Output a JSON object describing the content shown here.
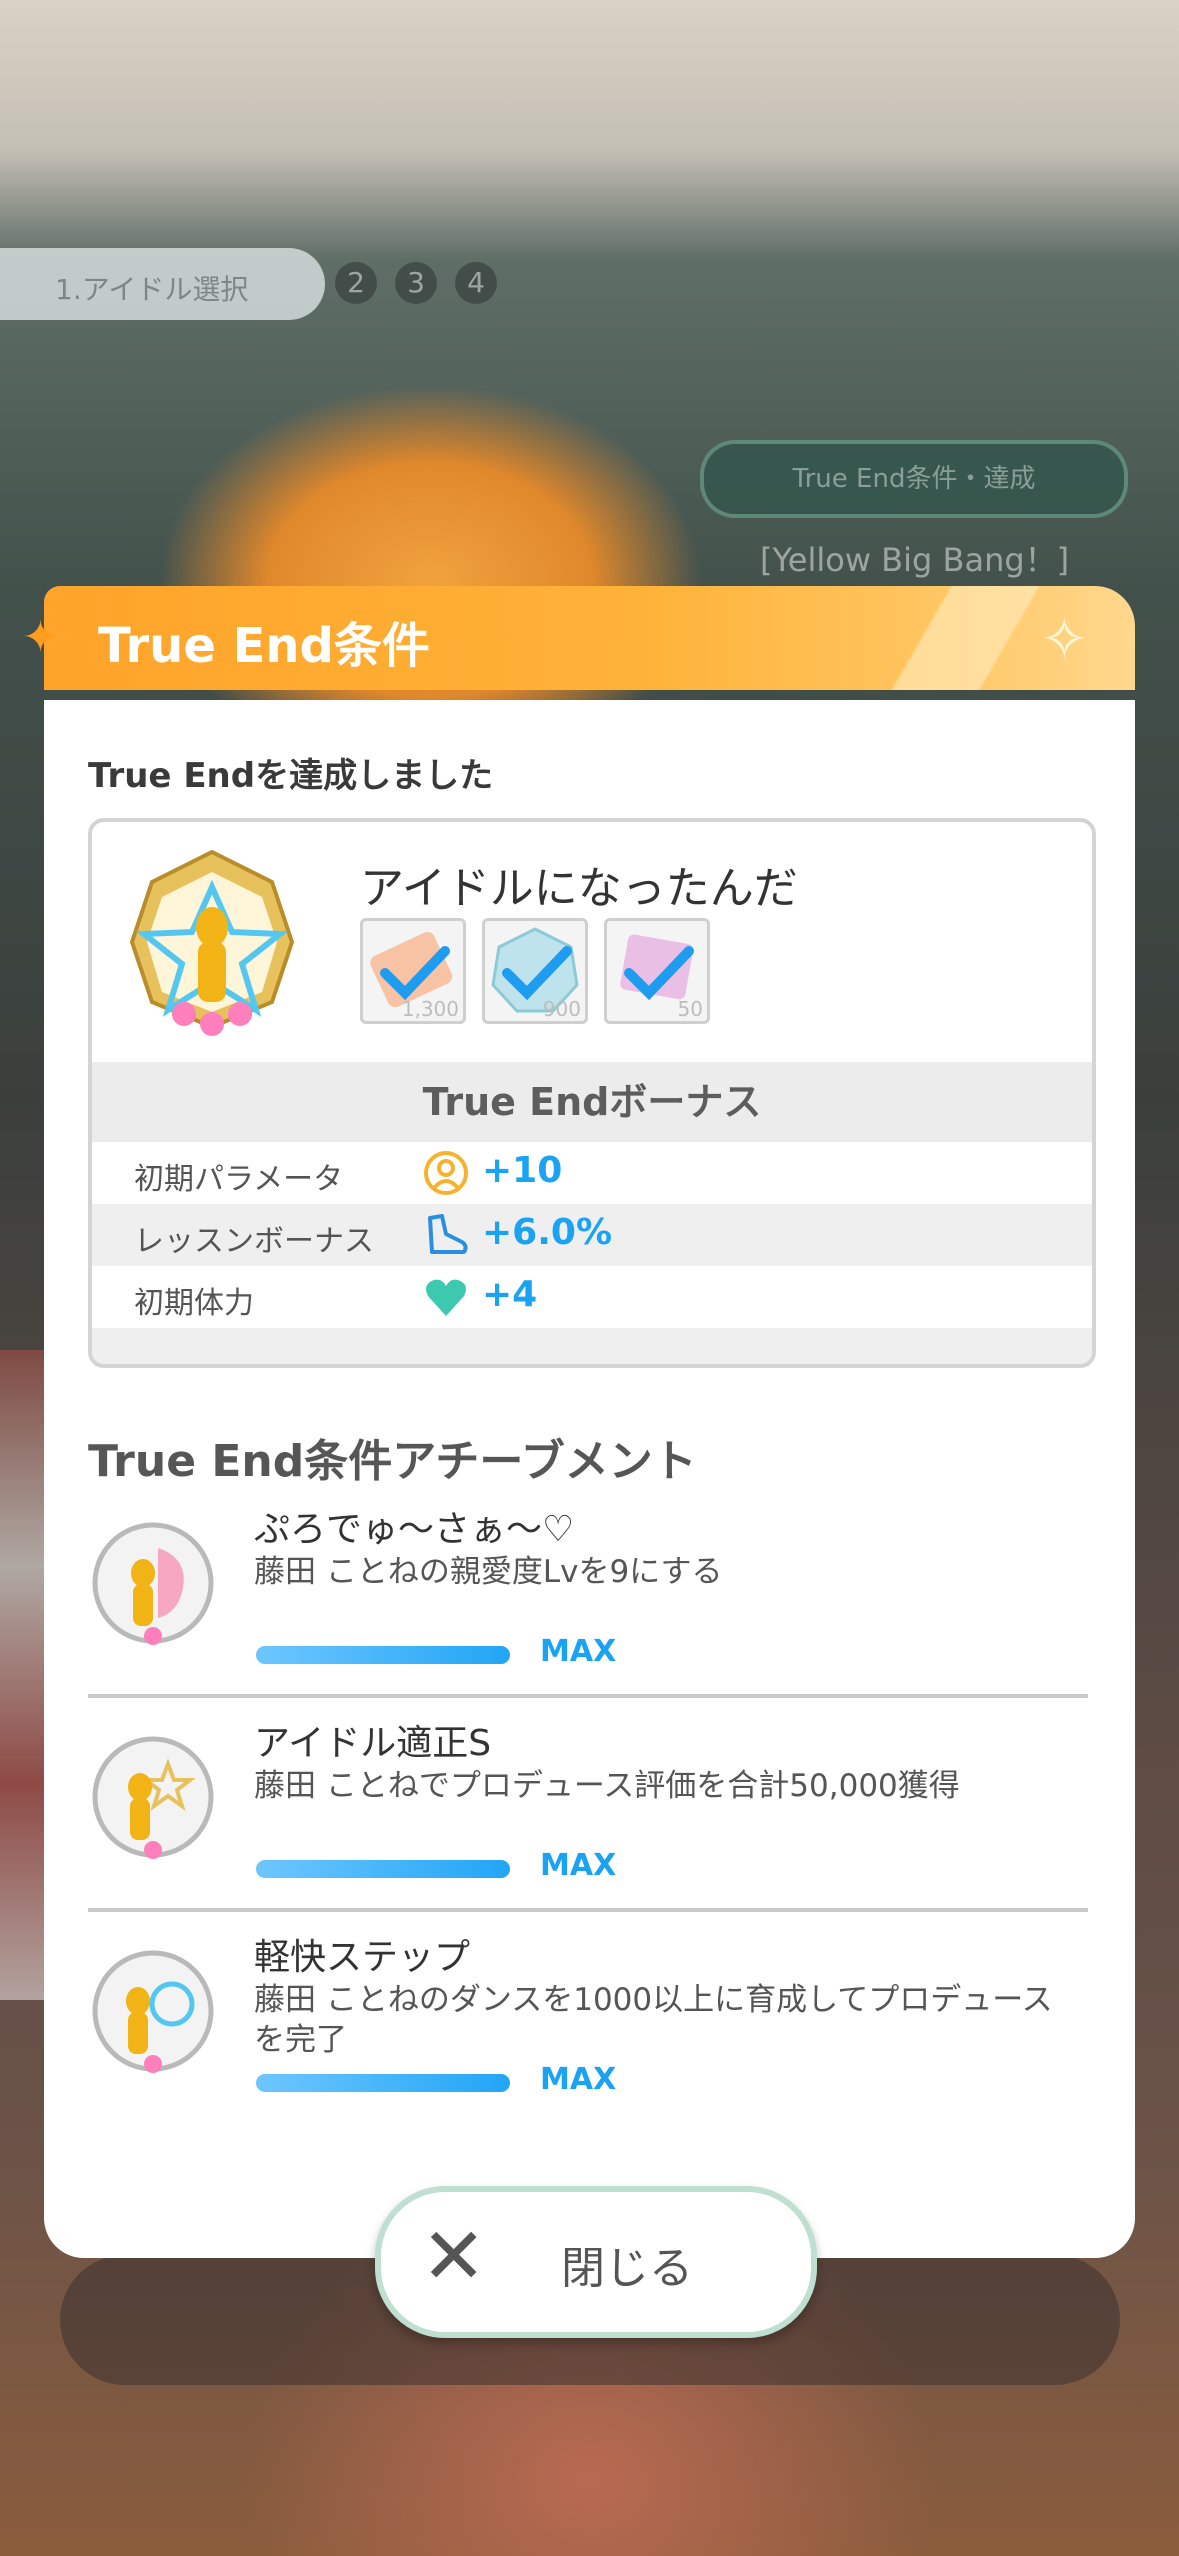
{
  "background": {
    "idol_select": "1.アイドル選択",
    "steps": [
      "2",
      "3",
      "4"
    ],
    "true_end_pill": "True End条件・達成",
    "song": "[Yellow Big Bang！]"
  },
  "dialog": {
    "title": "True End条件",
    "achieved_label": "True Endを達成しました",
    "card": {
      "title": "アイドルになったんだ",
      "items": [
        {
          "count": "1,300"
        },
        {
          "count": "900"
        },
        {
          "count": "50"
        }
      ],
      "bonus_header": "True Endボーナス",
      "bonuses": [
        {
          "label": "初期パラメータ",
          "value": "+10",
          "icon": "person-icon"
        },
        {
          "label": "レッスンボーナス",
          "value": "+6.0%",
          "icon": "shoe-icon"
        },
        {
          "label": "初期体力",
          "value": "+4",
          "icon": "heart-icon"
        }
      ]
    },
    "achievements_title": "True End条件アチーブメント",
    "achievements": [
      {
        "name": "ぷろでゅ〜さぁ〜♡",
        "desc": "藤田 ことねの親愛度Lvを9にする",
        "status": "MAX"
      },
      {
        "name": "アイドル適正S",
        "desc": "藤田 ことねでプロデュース評価を合計50,000獲得",
        "status": "MAX"
      },
      {
        "name": "軽快ステップ",
        "desc": "藤田 ことねのダンスを1000以上に育成してプロデュースを完了",
        "status": "MAX"
      }
    ],
    "close_label": "閉じる"
  },
  "colors": {
    "accent_orange": "#ffa32a",
    "value_blue": "#1aa2f3",
    "heart_teal": "#3dc9b0"
  }
}
